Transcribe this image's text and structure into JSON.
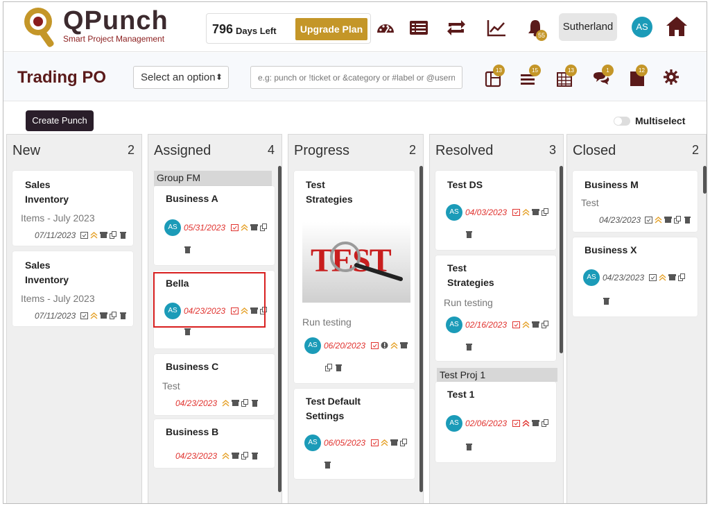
{
  "app": {
    "logo_title": "QPunch",
    "logo_sub": "Smart Project Management"
  },
  "plan": {
    "days": "796",
    "days_label": "Days Left",
    "upgrade_label": "Upgrade Plan"
  },
  "notifications": {
    "bell_count": "55"
  },
  "company": "Sutherland",
  "user": {
    "initials": "AS"
  },
  "page": {
    "title": "Trading PO",
    "select_label": "Select an option",
    "search_placeholder": "e.g: punch or !ticket or &category or #label or @username",
    "badges": [
      "13",
      "15",
      "13",
      "1",
      "12"
    ]
  },
  "actions": {
    "create_label": "Create Punch",
    "multiselect_label": "Multiselect"
  },
  "columns": [
    {
      "title": "New",
      "count": "2"
    },
    {
      "title": "Assigned",
      "count": "4"
    },
    {
      "title": "Progress",
      "count": "2"
    },
    {
      "title": "Resolved",
      "count": "3"
    },
    {
      "title": "Closed",
      "count": "2"
    }
  ],
  "cards": {
    "new1": {
      "title": "Sales Inventory",
      "sub": "Items - July 2023",
      "date": "07/11/2023"
    },
    "new2": {
      "title": "Sales Inventory",
      "sub": "Items - July 2023",
      "date": "07/11/2023"
    },
    "group_fm": "Group FM",
    "busA": {
      "title": "Business A",
      "date": "05/31/2023"
    },
    "bella": {
      "title": "Bella",
      "date": "04/23/2023"
    },
    "busC": {
      "title": "Business C",
      "sub": "Test",
      "date": "04/23/2023"
    },
    "busB": {
      "title": "Business B",
      "date": "04/23/2023"
    },
    "testStrat": {
      "title": "Test Strategies",
      "sub": "Run testing",
      "date": "06/20/2023",
      "image_text": "TEST"
    },
    "testDefault": {
      "title": "Test Default Settings",
      "date": "06/05/2023"
    },
    "testDS": {
      "title": "Test DS",
      "date": "04/03/2023"
    },
    "testStrat2": {
      "title": "Test Strategies",
      "sub": "Run testing",
      "date": "02/16/2023"
    },
    "group_proj": "Test Proj 1",
    "test1": {
      "title": "Test 1",
      "date": "02/06/2023"
    },
    "busM": {
      "title": "Business M",
      "sub": "Test",
      "date": "04/23/2023"
    },
    "busX": {
      "title": "Business X",
      "date": "04/23/2023"
    }
  },
  "colors": {
    "accent": "#c49628",
    "brand": "#5a1a1a",
    "avatar": "#1b9bb8",
    "date": "#e0322e"
  }
}
